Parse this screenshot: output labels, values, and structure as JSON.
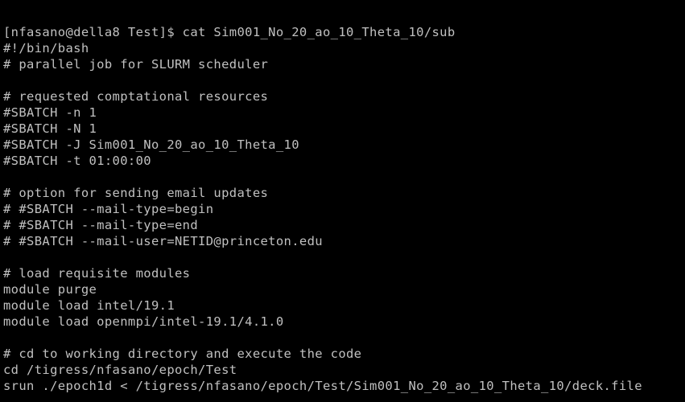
{
  "terminal": {
    "background": "#000000",
    "foreground": "#c0c0c0",
    "lines": [
      "[nfasano@della8 Test]$ cat Sim001_No_20_ao_10_Theta_10/sub",
      "#!/bin/bash",
      "# parallel job for SLURM scheduler",
      "",
      "# requested comptational resources",
      "#SBATCH -n 1",
      "#SBATCH -N 1",
      "#SBATCH -J Sim001_No_20_ao_10_Theta_10",
      "#SBATCH -t 01:00:00",
      "",
      "# option for sending email updates",
      "# #SBATCH --mail-type=begin",
      "# #SBATCH --mail-type=end",
      "# #SBATCH --mail-user=NETID@princeton.edu",
      "",
      "# load requisite modules",
      "module purge",
      "module load intel/19.1",
      "module load openmpi/intel-19.1/4.1.0",
      "",
      "# cd to working directory and execute the code",
      "cd /tigress/nfasano/epoch/Test",
      "srun ./epoch1d < /tigress/nfasano/epoch/Test/Sim001_No_20_ao_10_Theta_10/deck.file"
    ]
  }
}
